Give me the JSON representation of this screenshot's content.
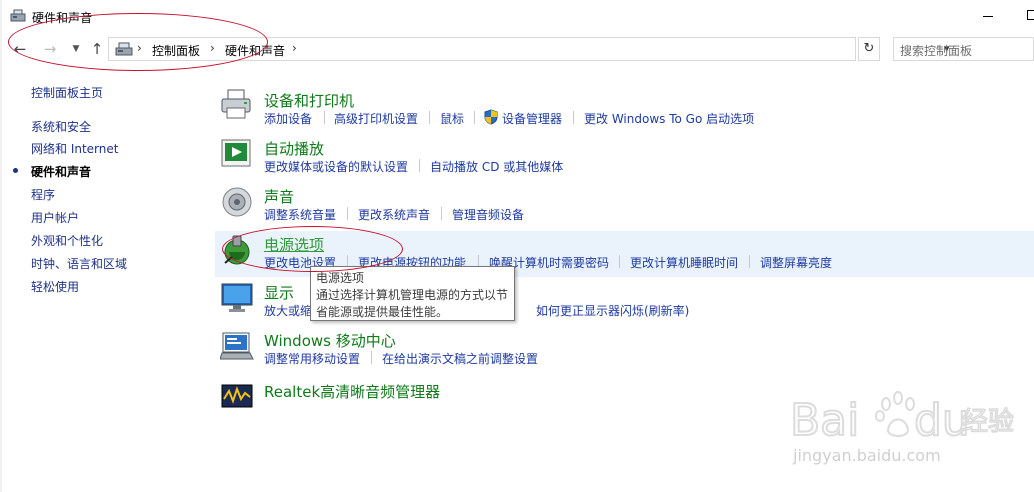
{
  "window": {
    "title": "硬件和声音"
  },
  "address": {
    "crumbs": [
      "控制面板",
      "硬件和声音"
    ],
    "search_placeholder": "搜索控制面板"
  },
  "sidebar": {
    "items": [
      {
        "label": "控制面板主页",
        "active": false
      },
      {
        "label": "系统和安全",
        "active": false
      },
      {
        "label": "网络和 Internet",
        "active": false
      },
      {
        "label": "硬件和声音",
        "active": true
      },
      {
        "label": "程序",
        "active": false
      },
      {
        "label": "用户帐户",
        "active": false
      },
      {
        "label": "外观和个性化",
        "active": false
      },
      {
        "label": "时钟、语言和区域",
        "active": false
      },
      {
        "label": "轻松使用",
        "active": false
      }
    ]
  },
  "categories": [
    {
      "title": "设备和打印机",
      "icon": "printer-icon",
      "links": [
        "添加设备",
        "高级打印机设置",
        "鼠标",
        "设备管理器",
        "更改 Windows To Go 启动选项"
      ]
    },
    {
      "title": "自动播放",
      "icon": "autoplay-icon",
      "links": [
        "更改媒体或设备的默认设置",
        "自动播放 CD 或其他媒体"
      ]
    },
    {
      "title": "声音",
      "icon": "speaker-icon",
      "links": [
        "调整系统音量",
        "更改系统声音",
        "管理音频设备"
      ]
    },
    {
      "title": "电源选项",
      "icon": "power-icon",
      "links": [
        "更改电池设置",
        "更改电源按钮的功能",
        "唤醒计算机时需要密码",
        "更改计算机睡眠时间",
        "调整屏幕亮度"
      ]
    },
    {
      "title": "显示",
      "icon": "monitor-icon",
      "links": [
        "放大或缩",
        "如何更正显示器闪烁(刷新率)"
      ]
    },
    {
      "title": "Windows 移动中心",
      "icon": "mobility-center-icon",
      "links": [
        "调整常用移动设置",
        "在给出演示文稿之前调整设置"
      ]
    },
    {
      "title": "Realtek高清晰音频管理器",
      "icon": "realtek-icon",
      "links": []
    }
  ],
  "tooltip": {
    "title": "电源选项",
    "body_line1": "通过选择计算机管理电源的方式以节",
    "body_line2": "省能源或提供最佳性能。"
  },
  "watermark": {
    "text": "jingyan.baidu.com"
  },
  "colors": {
    "category_title": "#0f7a1a",
    "link": "#1e3aa0",
    "annotation": "#c8102e",
    "highlight": "#eaf3fc"
  }
}
